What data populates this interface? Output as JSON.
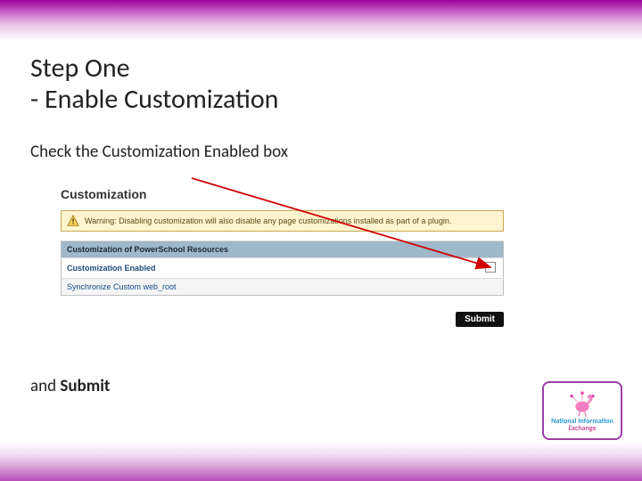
{
  "title": {
    "line1": "Step One",
    "line2": "-   Enable Customization"
  },
  "instruction_top": "Check the Customization Enabled box",
  "instruction_bottom": {
    "prefix": "and ",
    "bold": "Submit"
  },
  "panel": {
    "heading": "Customization",
    "warning": "Warning: Disabling customization will also disable any page customizations installed as part of a plugin.",
    "table_header": "Customization of PowerSchool Resources",
    "row_enabled_label": "Customization Enabled",
    "row_sync_label": "Synchronize Custom web_root",
    "submit_label": "Submit"
  },
  "badge": {
    "line1": "National Information",
    "line2": "Exchange"
  }
}
